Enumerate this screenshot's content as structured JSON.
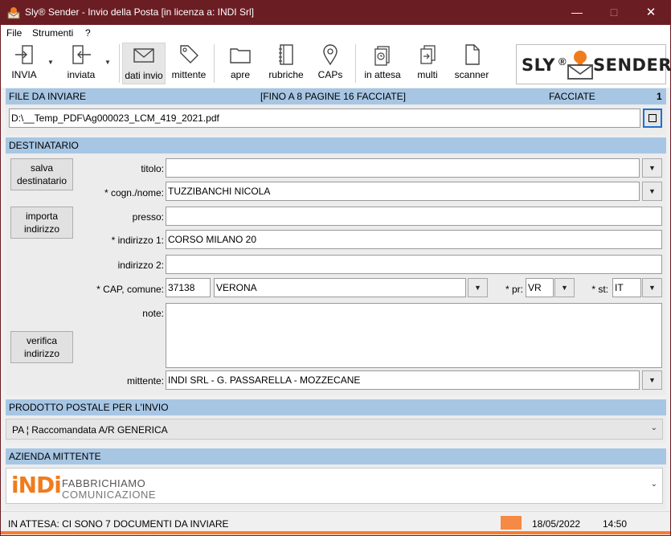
{
  "window": {
    "title": "Sly® Sender - Invio della Posta [in licenza a: INDI Srl]"
  },
  "menu": [
    "File",
    "Strumenti",
    "?"
  ],
  "toolbar": {
    "invia": "INVIA",
    "inviata": "inviata",
    "dati_invio": "dati invio",
    "mittente": "mittente",
    "apre": "apre",
    "rubriche": "rubriche",
    "caps": "CAPs",
    "in_attesa": "in attesa",
    "multi": "multi",
    "scanner": "scanner",
    "logo_left": "SLY",
    "logo_reg": "®",
    "logo_right": "SENDER"
  },
  "file_section": {
    "header": "FILE DA INVIARE",
    "limit_note": "[FINO A 8 PAGINE 16 FACCIATE]",
    "facciate_label": "FACCIATE",
    "facciate_count": "1",
    "file_path": "D:\\__Temp_PDF\\Ag000023_LCM_419_2021.pdf"
  },
  "recipient": {
    "header": "DESTINATARIO",
    "btn_save": "salva destinatario",
    "btn_import": "importa indirizzo",
    "btn_verify": "verifica indirizzo",
    "labels": {
      "titolo": "titolo:",
      "cognome": "* cogn./nome:",
      "presso": "presso:",
      "indirizzo1": "* indirizzo 1:",
      "indirizzo2": "indirizzo 2:",
      "cap_comune": "* CAP, comune:",
      "pr": "* pr:",
      "st": "* st:",
      "note": "note:",
      "mittente": "mittente:"
    },
    "values": {
      "titolo": "",
      "cognome": "TUZZIBANCHI NICOLA",
      "presso": "",
      "indirizzo1": "CORSO MILANO 20",
      "indirizzo2": "",
      "cap": "37138",
      "comune": "VERONA",
      "pr": "VR",
      "st": "IT",
      "note": "",
      "mittente": "INDI SRL - G. PASSARELLA - MOZZECANE"
    }
  },
  "product": {
    "header": "PRODOTTO POSTALE PER L'INVIO",
    "selected": "PA ¦ Raccomandata A/R GENERICA"
  },
  "company": {
    "header": "AZIENDA MITTENTE",
    "logo_brand": "iNDi",
    "logo_line1": "FABBRICHIAMO",
    "logo_line2": "COMUNICAZIONE"
  },
  "status": {
    "message": "IN ATTESA: CI SONO 7 DOCUMENTI DA INVIARE",
    "date": "18/05/2022",
    "time": "14:50"
  },
  "colors": {
    "titlebar": "#6b1d24",
    "section_header": "#a7c6e4",
    "accent_orange": "#ff7a2f",
    "status_swatch": "#f58a44",
    "company_logo_orange": "#f07c1e"
  }
}
